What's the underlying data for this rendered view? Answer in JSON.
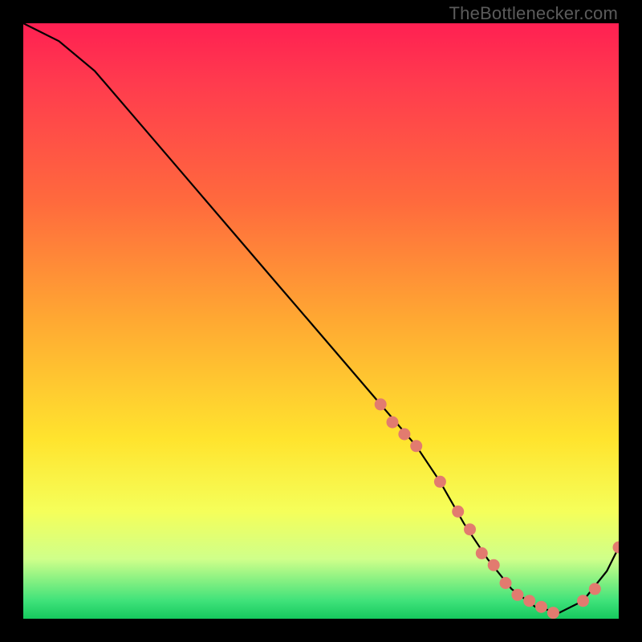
{
  "attribution": "TheBottlenecker.com",
  "chart_data": {
    "type": "line",
    "title": "",
    "xlabel": "",
    "ylabel": "",
    "xlim": [
      0,
      100
    ],
    "ylim": [
      0,
      100
    ],
    "x": [
      0,
      6,
      12,
      18,
      24,
      30,
      36,
      42,
      48,
      54,
      60,
      66,
      70,
      74,
      78,
      82,
      86,
      90,
      94,
      98,
      100
    ],
    "values": [
      100,
      97,
      92,
      85,
      78,
      71,
      64,
      57,
      50,
      43,
      36,
      29,
      23,
      16,
      10,
      5,
      2,
      1,
      3,
      8,
      12
    ],
    "marker_points": {
      "x": [
        60,
        62,
        64,
        66,
        70,
        73,
        75,
        77,
        79,
        81,
        83,
        85,
        87,
        89,
        94,
        96,
        100
      ],
      "y": [
        36,
        33,
        31,
        29,
        23,
        18,
        15,
        11,
        9,
        6,
        4,
        3,
        2,
        1,
        3,
        5,
        12
      ]
    },
    "colors": {
      "line": "#000000",
      "marker": "#e27b6f",
      "gradient_top": "#ff2052",
      "gradient_bottom": "#16c95e"
    }
  }
}
